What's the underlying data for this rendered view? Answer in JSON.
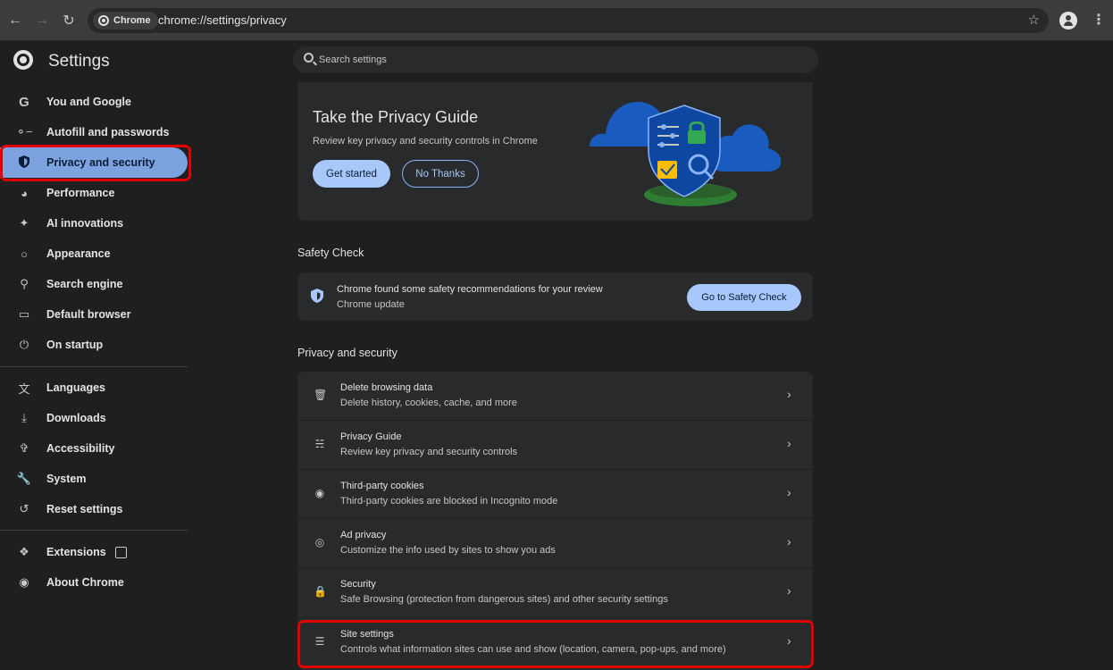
{
  "browser": {
    "chip_label": "Chrome",
    "url": "chrome://settings/privacy"
  },
  "header": {
    "title": "Settings",
    "search_placeholder": "Search settings"
  },
  "sidebar": {
    "items": [
      {
        "label": "You and Google",
        "icon": "google-icon"
      },
      {
        "label": "Autofill and passwords",
        "icon": "key-icon"
      },
      {
        "label": "Privacy and security",
        "icon": "shield-icon"
      },
      {
        "label": "Performance",
        "icon": "speedometer-icon"
      },
      {
        "label": "AI innovations",
        "icon": "sparkle-icon"
      },
      {
        "label": "Appearance",
        "icon": "palette-icon"
      },
      {
        "label": "Search engine",
        "icon": "search-icon"
      },
      {
        "label": "Default browser",
        "icon": "browser-window-icon"
      },
      {
        "label": "On startup",
        "icon": "power-icon"
      },
      {
        "label": "Languages",
        "icon": "translate-icon"
      },
      {
        "label": "Downloads",
        "icon": "download-icon"
      },
      {
        "label": "Accessibility",
        "icon": "accessibility-icon"
      },
      {
        "label": "System",
        "icon": "wrench-icon"
      },
      {
        "label": "Reset settings",
        "icon": "reset-icon"
      },
      {
        "label": "Extensions",
        "icon": "puzzle-icon"
      },
      {
        "label": "About Chrome",
        "icon": "chrome-icon"
      }
    ]
  },
  "privacy_guide": {
    "title": "Take the Privacy Guide",
    "description": "Review key privacy and security controls in Chrome",
    "get_started": "Get started",
    "no_thanks": "No Thanks"
  },
  "safety_check": {
    "section_title": "Safety Check",
    "title": "Chrome found some safety recommendations for your review",
    "subtitle": "Chrome update",
    "button": "Go to Safety Check"
  },
  "privacy_section": {
    "section_title": "Privacy and security",
    "rows": [
      {
        "title": "Delete browsing data",
        "subtitle": "Delete history, cookies, cache, and more",
        "icon": "trash-icon"
      },
      {
        "title": "Privacy Guide",
        "subtitle": "Review key privacy and security controls",
        "icon": "signpost-icon"
      },
      {
        "title": "Third-party cookies",
        "subtitle": "Third-party cookies are blocked in Incognito mode",
        "icon": "cookie-icon"
      },
      {
        "title": "Ad privacy",
        "subtitle": "Customize the info used by sites to show you ads",
        "icon": "ad-target-icon"
      },
      {
        "title": "Security",
        "subtitle": "Safe Browsing (protection from dangerous sites) and other security settings",
        "icon": "lock-icon"
      },
      {
        "title": "Site settings",
        "subtitle": "Controls what information sites can use and show (location, camera, pop-ups, and more)",
        "icon": "sliders-icon"
      }
    ]
  }
}
